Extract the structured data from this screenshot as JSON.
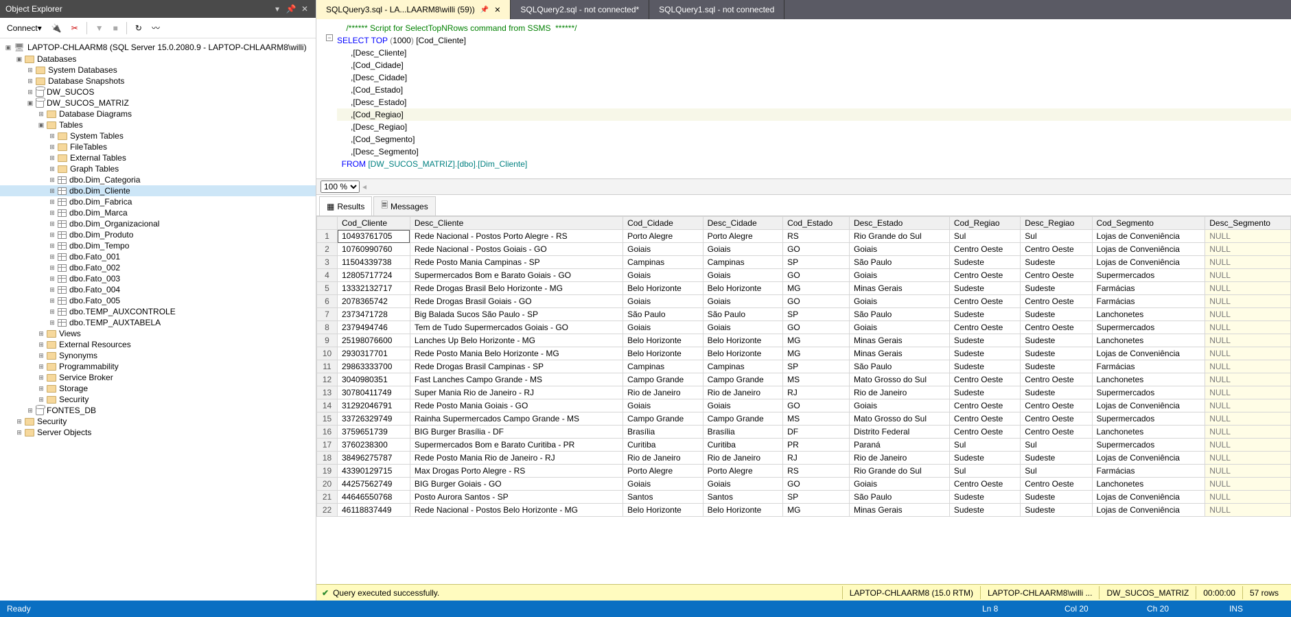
{
  "panel": {
    "title": "Object Explorer",
    "connect_label": "Connect"
  },
  "tree": {
    "server": "LAPTOP-CHLAARM8 (SQL Server 15.0.2080.9 - LAPTOP-CHLAARM8\\willi)",
    "databases": "Databases",
    "sysdb": "System Databases",
    "snapshots": "Database Snapshots",
    "dw_sucos": "DW_SUCOS",
    "dw_sucos_matriz": "DW_SUCOS_MATRIZ",
    "db_diagrams": "Database Diagrams",
    "tables": "Tables",
    "sys_tables": "System Tables",
    "file_tables": "FileTables",
    "ext_tables": "External Tables",
    "graph_tables": "Graph Tables",
    "t_categoria": "dbo.Dim_Categoria",
    "t_cliente": "dbo.Dim_Cliente",
    "t_fabrica": "dbo.Dim_Fabrica",
    "t_marca": "dbo.Dim_Marca",
    "t_org": "dbo.Dim_Organizacional",
    "t_produto": "dbo.Dim_Produto",
    "t_tempo": "dbo.Dim_Tempo",
    "t_f001": "dbo.Fato_001",
    "t_f002": "dbo.Fato_002",
    "t_f003": "dbo.Fato_003",
    "t_f004": "dbo.Fato_004",
    "t_f005": "dbo.Fato_005",
    "t_tmp1": "dbo.TEMP_AUXCONTROLE",
    "t_tmp2": "dbo.TEMP_AUXTABELA",
    "views": "Views",
    "ext_res": "External Resources",
    "synonyms": "Synonyms",
    "prog": "Programmability",
    "sbroker": "Service Broker",
    "storage": "Storage",
    "security": "Security",
    "fontes_db": "FONTES_DB",
    "root_security": "Security",
    "server_objects": "Server Objects"
  },
  "tabs": [
    {
      "label": "SQLQuery3.sql - LA...LAARM8\\willi (59))",
      "active": true
    },
    {
      "label": "SQLQuery2.sql - not connected*",
      "active": false
    },
    {
      "label": "SQLQuery1.sql - not connected",
      "active": false
    }
  ],
  "editor": {
    "comment": "/****** Script for SelectTopNRows command from SSMS  ******/",
    "l2a": "SELECT",
    "l2b": " TOP ",
    "l2c": "(",
    "l2d": "1000",
    "l2e": ") ",
    "l2f": "[Cod_Cliente]",
    "l3": "      ,[Desc_Cliente]",
    "l4": "      ,[Cod_Cidade]",
    "l5": "      ,[Desc_Cidade]",
    "l6": "      ,[Cod_Estado]",
    "l7": "      ,[Desc_Estado]",
    "l8": "      ,[Cod_Regiao]",
    "l9": "      ,[Desc_Regiao]",
    "l10": "      ,[Cod_Segmento]",
    "l11": "      ,[Desc_Segmento]",
    "l12a": "  FROM ",
    "l12b": "[DW_SUCOS_MATRIZ]",
    ".": ".",
    "l12c": "[dbo]",
    "l12d": "[Dim_Cliente]"
  },
  "zoom": "100 %",
  "rtabs": {
    "results": "Results",
    "messages": "Messages"
  },
  "columns": [
    "Cod_Cliente",
    "Desc_Cliente",
    "Cod_Cidade",
    "Desc_Cidade",
    "Cod_Estado",
    "Desc_Estado",
    "Cod_Regiao",
    "Desc_Regiao",
    "Cod_Segmento",
    "Desc_Segmento"
  ],
  "rows": [
    [
      "10493761705",
      "Rede Nacional - Postos Porto Alegre - RS",
      "Porto Alegre",
      "Porto Alegre",
      "RS",
      "Rio Grande do Sul",
      "Sul",
      "Sul",
      "Lojas de Conveniência",
      "NULL"
    ],
    [
      "10760990760",
      "Rede Nacional - Postos Goiais - GO",
      "Goiais",
      "Goiais",
      "GO",
      "Goiais",
      "Centro Oeste",
      "Centro Oeste",
      "Lojas de Conveniência",
      "NULL"
    ],
    [
      "11504339738",
      "Rede Posto Mania Campinas - SP",
      "Campinas",
      "Campinas",
      "SP",
      "São Paulo",
      "Sudeste",
      "Sudeste",
      "Lojas de Conveniência",
      "NULL"
    ],
    [
      "12805717724",
      "Supermercados Bom e Barato Goiais - GO",
      "Goiais",
      "Goiais",
      "GO",
      "Goiais",
      "Centro Oeste",
      "Centro Oeste",
      "Supermercados",
      "NULL"
    ],
    [
      "13332132717",
      "Rede Drogas Brasil Belo Horizonte - MG",
      "Belo Horizonte",
      "Belo Horizonte",
      "MG",
      "Minas Gerais",
      "Sudeste",
      "Sudeste",
      "Farmácias",
      "NULL"
    ],
    [
      "2078365742",
      "Rede Drogas Brasil Goiais - GO",
      "Goiais",
      "Goiais",
      "GO",
      "Goiais",
      "Centro Oeste",
      "Centro Oeste",
      "Farmácias",
      "NULL"
    ],
    [
      "2373471728",
      "Big Balada Sucos São Paulo - SP",
      "São Paulo",
      "São Paulo",
      "SP",
      "São Paulo",
      "Sudeste",
      "Sudeste",
      "Lanchonetes",
      "NULL"
    ],
    [
      "2379494746",
      "Tem de Tudo Supermercados Goiais - GO",
      "Goiais",
      "Goiais",
      "GO",
      "Goiais",
      "Centro Oeste",
      "Centro Oeste",
      "Supermercados",
      "NULL"
    ],
    [
      "25198076600",
      "Lanches Up Belo Horizonte - MG",
      "Belo Horizonte",
      "Belo Horizonte",
      "MG",
      "Minas Gerais",
      "Sudeste",
      "Sudeste",
      "Lanchonetes",
      "NULL"
    ],
    [
      "2930317701",
      "Rede Posto Mania Belo Horizonte - MG",
      "Belo Horizonte",
      "Belo Horizonte",
      "MG",
      "Minas Gerais",
      "Sudeste",
      "Sudeste",
      "Lojas de Conveniência",
      "NULL"
    ],
    [
      "29863333700",
      "Rede Drogas Brasil Campinas - SP",
      "Campinas",
      "Campinas",
      "SP",
      "São Paulo",
      "Sudeste",
      "Sudeste",
      "Farmácias",
      "NULL"
    ],
    [
      "3040980351",
      "Fast Lanches Campo Grande - MS",
      "Campo Grande",
      "Campo Grande",
      "MS",
      "Mato Grosso do Sul",
      "Centro Oeste",
      "Centro Oeste",
      "Lanchonetes",
      "NULL"
    ],
    [
      "30780411749",
      "Super Mania Rio de Janeiro - RJ",
      "Rio de Janeiro",
      "Rio de Janeiro",
      "RJ",
      "Rio de Janeiro",
      "Sudeste",
      "Sudeste",
      "Supermercados",
      "NULL"
    ],
    [
      "31292046791",
      "Rede Posto Mania Goiais - GO",
      "Goiais",
      "Goiais",
      "GO",
      "Goiais",
      "Centro Oeste",
      "Centro Oeste",
      "Lojas de Conveniência",
      "NULL"
    ],
    [
      "33726329749",
      "Rainha Supermercados Campo Grande - MS",
      "Campo Grande",
      "Campo Grande",
      "MS",
      "Mato Grosso do Sul",
      "Centro Oeste",
      "Centro Oeste",
      "Supermercados",
      "NULL"
    ],
    [
      "3759651739",
      "BIG Burger Brasília - DF",
      "Brasília",
      "Brasília",
      "DF",
      "Distrito Federal",
      "Centro Oeste",
      "Centro Oeste",
      "Lanchonetes",
      "NULL"
    ],
    [
      "3760238300",
      "Supermercados Bom e Barato Curitiba - PR",
      "Curitiba",
      "Curitiba",
      "PR",
      "Paraná",
      "Sul",
      "Sul",
      "Supermercados",
      "NULL"
    ],
    [
      "38496275787",
      "Rede Posto Mania Rio de Janeiro - RJ",
      "Rio de Janeiro",
      "Rio de Janeiro",
      "RJ",
      "Rio de Janeiro",
      "Sudeste",
      "Sudeste",
      "Lojas de Conveniência",
      "NULL"
    ],
    [
      "43390129715",
      "Max Drogas Porto Alegre - RS",
      "Porto Alegre",
      "Porto Alegre",
      "RS",
      "Rio Grande do Sul",
      "Sul",
      "Sul",
      "Farmácias",
      "NULL"
    ],
    [
      "44257562749",
      "BIG Burger Goiais - GO",
      "Goiais",
      "Goiais",
      "GO",
      "Goiais",
      "Centro Oeste",
      "Centro Oeste",
      "Lanchonetes",
      "NULL"
    ],
    [
      "44646550768",
      "Posto Aurora Santos - SP",
      "Santos",
      "Santos",
      "SP",
      "São Paulo",
      "Sudeste",
      "Sudeste",
      "Lojas de Conveniência",
      "NULL"
    ],
    [
      "46118837449",
      "Rede Nacional - Postos Belo Horizonte - MG",
      "Belo Horizonte",
      "Belo Horizonte",
      "MG",
      "Minas Gerais",
      "Sudeste",
      "Sudeste",
      "Lojas de Conveniência",
      "NULL"
    ]
  ],
  "exec": {
    "msg": "Query executed successfully.",
    "server": "LAPTOP-CHLAARM8 (15.0 RTM)",
    "user": "LAPTOP-CHLAARM8\\willi ...",
    "db": "DW_SUCOS_MATRIZ",
    "time": "00:00:00",
    "rows": "57 rows"
  },
  "status": {
    "ready": "Ready",
    "ln": "Ln 8",
    "col": "Col 20",
    "ch": "Ch 20",
    "ins": "INS"
  }
}
